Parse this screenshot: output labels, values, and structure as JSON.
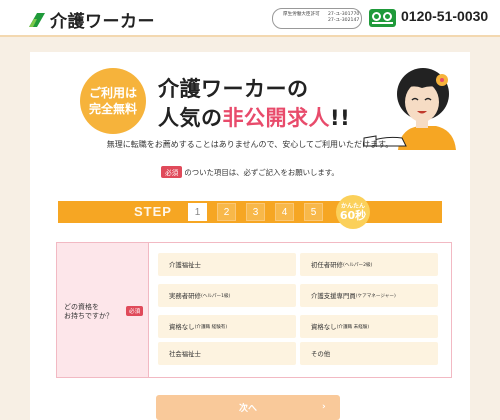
{
  "header": {
    "logo_text": "介護ワーカー",
    "license": [
      {
        "label": "厚生労働大臣許可",
        "value": "27-ユ-301770"
      },
      {
        "label": "",
        "value": "27-ユ-302147"
      }
    ],
    "phone": "0120-51-0030",
    "freedial_icon": "freedial-icon"
  },
  "hero": {
    "badge_line1": "ご利用は",
    "badge_line2": "完全無料",
    "headline_line1": "介護ワーカーの",
    "headline_line2_prefix": "人気の",
    "headline_line2_highlight": "非公開求人",
    "headline_line2_suffix": "!!",
    "subtext": "無理に転職をお薦めすることはありませんので、安心してご利用いただけます。"
  },
  "required_note": {
    "tag": "必須",
    "text": "のついた項目は、必ずご記入をお願いします。"
  },
  "steps": {
    "title": "STEP",
    "items": [
      "1",
      "2",
      "3",
      "4",
      "5"
    ],
    "current": 1,
    "easy_line1": "かんたん",
    "easy_line2": "60秒"
  },
  "question": {
    "label": "どの資格を お持ちですか？",
    "label_line1": "どの資格を",
    "label_line2": "お持ちですか？",
    "required_tag": "必須",
    "options": [
      {
        "main": "介護福祉士",
        "sub": ""
      },
      {
        "main": "初任者研修",
        "sub": "(ヘルパー2級)"
      },
      {
        "main": "実務者研修",
        "sub": "(ヘルパー1級)"
      },
      {
        "main": "介護支援専門員",
        "sub": "(ケアマネージャー)"
      },
      {
        "main": "資格なし",
        "sub": "(介護職 経験有)"
      },
      {
        "main": "資格なし",
        "sub": "(介護職 未経験)"
      },
      {
        "main": "社会福祉士",
        "sub": ""
      },
      {
        "main": "その他",
        "sub": ""
      }
    ]
  },
  "next_button": {
    "label": "次へ",
    "arrow": "›"
  },
  "colors": {
    "accent_orange": "#f6a623",
    "badge_yellow": "#f6b33b",
    "highlight_pink": "#e84b6b",
    "required_red": "#e04a5a",
    "freedial_green": "#1f9a3a"
  }
}
